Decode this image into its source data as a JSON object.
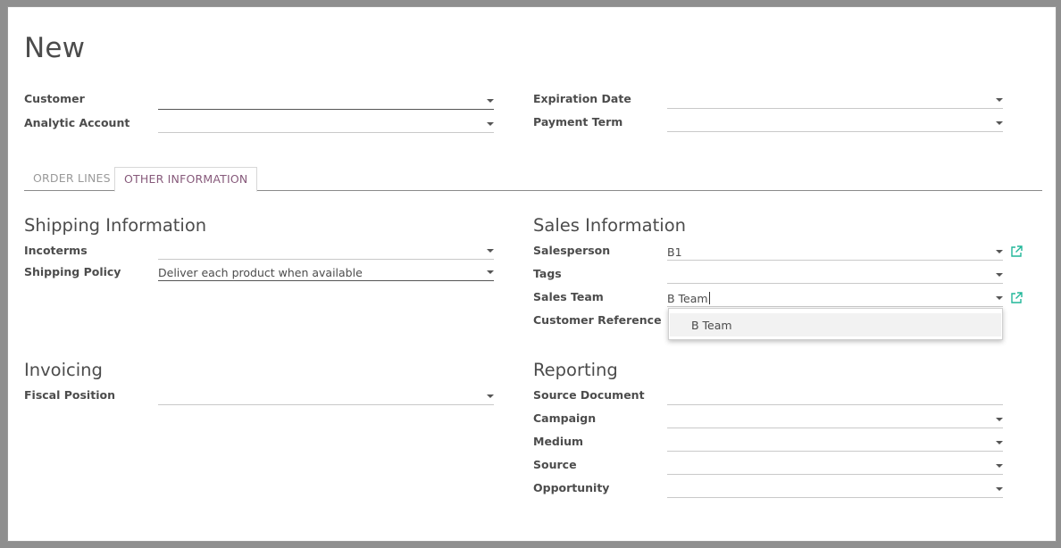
{
  "page": {
    "title": "New"
  },
  "header_fields": {
    "customer": {
      "label": "Customer",
      "value": ""
    },
    "analytic_account": {
      "label": "Analytic Account",
      "value": ""
    },
    "expiration_date": {
      "label": "Expiration Date",
      "value": ""
    },
    "payment_term": {
      "label": "Payment Term",
      "value": ""
    }
  },
  "tabs": [
    {
      "label": "ORDER LINES",
      "active": false
    },
    {
      "label": "OTHER INFORMATION",
      "active": true
    }
  ],
  "shipping": {
    "title": "Shipping Information",
    "incoterms": {
      "label": "Incoterms",
      "value": ""
    },
    "shipping_policy": {
      "label": "Shipping Policy",
      "value": "Deliver each product when available"
    }
  },
  "sales": {
    "title": "Sales Information",
    "salesperson": {
      "label": "Salesperson",
      "value": "B1"
    },
    "tags": {
      "label": "Tags",
      "value": ""
    },
    "sales_team": {
      "label": "Sales Team",
      "value": "B Team"
    },
    "customer_reference": {
      "label": "Customer Reference",
      "value": ""
    }
  },
  "autocomplete": {
    "options": [
      "B Team"
    ]
  },
  "invoicing": {
    "title": "Invoicing",
    "fiscal_position": {
      "label": "Fiscal Position",
      "value": ""
    }
  },
  "reporting": {
    "title": "Reporting",
    "source_document": {
      "label": "Source Document",
      "value": ""
    },
    "campaign": {
      "label": "Campaign",
      "value": ""
    },
    "medium": {
      "label": "Medium",
      "value": ""
    },
    "source": {
      "label": "Source",
      "value": ""
    },
    "opportunity": {
      "label": "Opportunity",
      "value": ""
    }
  },
  "colors": {
    "accent": "#875a7b",
    "link_icon": "#21b799",
    "text": "#4c4c4c"
  },
  "icons": [
    "caret-down-icon",
    "external-link-icon"
  ]
}
